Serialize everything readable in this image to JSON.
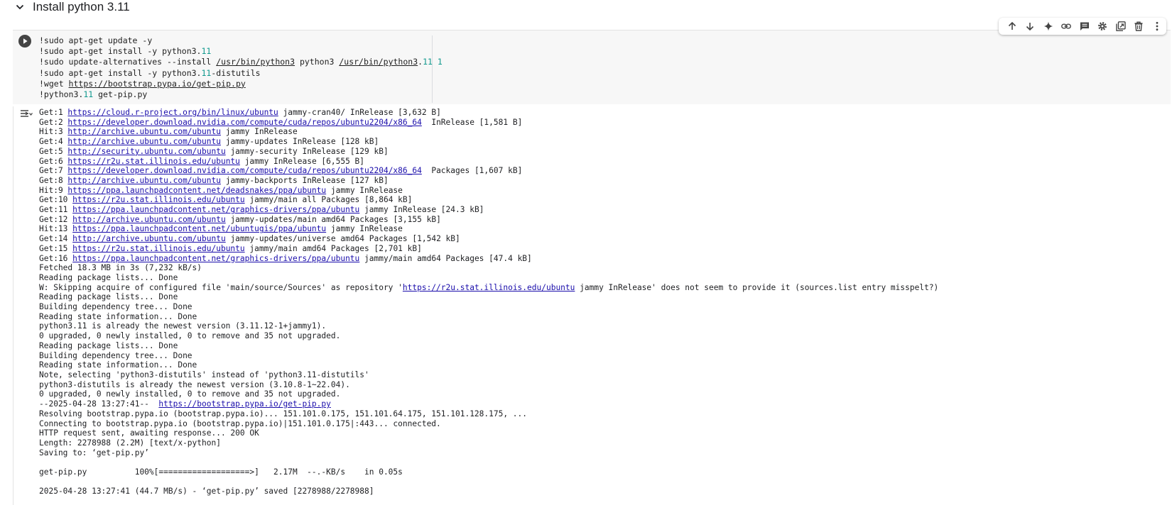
{
  "section": {
    "title": "Install python 3.11"
  },
  "toolbar": {
    "buttons": [
      "move-up",
      "move-down",
      "sparkle",
      "link",
      "comment",
      "settings",
      "mirror",
      "delete",
      "more"
    ]
  },
  "code": [
    [
      {
        "t": "!sudo apt-get update -y"
      }
    ],
    [
      {
        "t": "!sudo apt-get install -y python3."
      },
      {
        "t": "11",
        "c": "num"
      }
    ],
    [
      {
        "t": "!sudo update-alternatives --install "
      },
      {
        "t": "/usr/bin/python3",
        "c": "path"
      },
      {
        "t": " python3 "
      },
      {
        "t": "/usr/bin/python3",
        "c": "path"
      },
      {
        "t": ".",
        "c": ""
      },
      {
        "t": "11",
        "c": "num"
      },
      {
        "t": " "
      },
      {
        "t": "1",
        "c": "num"
      }
    ],
    [
      {
        "t": "!sudo apt-get install -y python3."
      },
      {
        "t": "11",
        "c": "num"
      },
      {
        "t": "-distutils"
      }
    ],
    [
      {
        "t": "!wget "
      },
      {
        "t": "https://bootstrap.pypa.io/get-pip.py",
        "c": "path"
      }
    ],
    [
      {
        "t": "!python3."
      },
      {
        "t": "11",
        "c": "num"
      },
      {
        "t": " get-pip.py"
      }
    ]
  ],
  "output": [
    [
      {
        "t": "Get:1 "
      },
      {
        "t": "https://cloud.r-project.org/bin/linux/ubuntu",
        "l": 1
      },
      {
        "t": " jammy-cran40/ InRelease [3,632 B]"
      }
    ],
    [
      {
        "t": "Get:2 "
      },
      {
        "t": "https://developer.download.nvidia.com/compute/cuda/repos/ubuntu2204/x86_64",
        "l": 1
      },
      {
        "t": "  InRelease [1,581 B]"
      }
    ],
    [
      {
        "t": "Hit:3 "
      },
      {
        "t": "http://archive.ubuntu.com/ubuntu",
        "l": 1
      },
      {
        "t": " jammy InRelease"
      }
    ],
    [
      {
        "t": "Get:4 "
      },
      {
        "t": "http://archive.ubuntu.com/ubuntu",
        "l": 1
      },
      {
        "t": " jammy-updates InRelease [128 kB]"
      }
    ],
    [
      {
        "t": "Get:5 "
      },
      {
        "t": "http://security.ubuntu.com/ubuntu",
        "l": 1
      },
      {
        "t": " jammy-security InRelease [129 kB]"
      }
    ],
    [
      {
        "t": "Get:6 "
      },
      {
        "t": "https://r2u.stat.illinois.edu/ubuntu",
        "l": 1
      },
      {
        "t": " jammy InRelease [6,555 B]"
      }
    ],
    [
      {
        "t": "Get:7 "
      },
      {
        "t": "https://developer.download.nvidia.com/compute/cuda/repos/ubuntu2204/x86_64",
        "l": 1
      },
      {
        "t": "  Packages [1,607 kB]"
      }
    ],
    [
      {
        "t": "Get:8 "
      },
      {
        "t": "http://archive.ubuntu.com/ubuntu",
        "l": 1
      },
      {
        "t": " jammy-backports InRelease [127 kB]"
      }
    ],
    [
      {
        "t": "Hit:9 "
      },
      {
        "t": "https://ppa.launchpadcontent.net/deadsnakes/ppa/ubuntu",
        "l": 1
      },
      {
        "t": " jammy InRelease"
      }
    ],
    [
      {
        "t": "Get:10 "
      },
      {
        "t": "https://r2u.stat.illinois.edu/ubuntu",
        "l": 1
      },
      {
        "t": " jammy/main all Packages [8,864 kB]"
      }
    ],
    [
      {
        "t": "Get:11 "
      },
      {
        "t": "https://ppa.launchpadcontent.net/graphics-drivers/ppa/ubuntu",
        "l": 1
      },
      {
        "t": " jammy InRelease [24.3 kB]"
      }
    ],
    [
      {
        "t": "Get:12 "
      },
      {
        "t": "http://archive.ubuntu.com/ubuntu",
        "l": 1
      },
      {
        "t": " jammy-updates/main amd64 Packages [3,155 kB]"
      }
    ],
    [
      {
        "t": "Hit:13 "
      },
      {
        "t": "https://ppa.launchpadcontent.net/ubuntugis/ppa/ubuntu",
        "l": 1
      },
      {
        "t": " jammy InRelease"
      }
    ],
    [
      {
        "t": "Get:14 "
      },
      {
        "t": "http://archive.ubuntu.com/ubuntu",
        "l": 1
      },
      {
        "t": " jammy-updates/universe amd64 Packages [1,542 kB]"
      }
    ],
    [
      {
        "t": "Get:15 "
      },
      {
        "t": "https://r2u.stat.illinois.edu/ubuntu",
        "l": 1
      },
      {
        "t": " jammy/main amd64 Packages [2,701 kB]"
      }
    ],
    [
      {
        "t": "Get:16 "
      },
      {
        "t": "https://ppa.launchpadcontent.net/graphics-drivers/ppa/ubuntu",
        "l": 1
      },
      {
        "t": " jammy/main amd64 Packages [47.4 kB]"
      }
    ],
    [
      {
        "t": "Fetched 18.3 MB in 3s (7,232 kB/s)"
      }
    ],
    [
      {
        "t": "Reading package lists... Done"
      }
    ],
    [
      {
        "t": "W: Skipping acquire of configured file 'main/source/Sources' as repository '"
      },
      {
        "t": "https://r2u.stat.illinois.edu/ubuntu",
        "l": 1
      },
      {
        "t": " jammy InRelease' does not seem to provide it (sources.list entry misspelt?)"
      }
    ],
    [
      {
        "t": "Reading package lists... Done"
      }
    ],
    [
      {
        "t": "Building dependency tree... Done"
      }
    ],
    [
      {
        "t": "Reading state information... Done"
      }
    ],
    [
      {
        "t": "python3.11 is already the newest version (3.11.12-1+jammy1)."
      }
    ],
    [
      {
        "t": "0 upgraded, 0 newly installed, 0 to remove and 35 not upgraded."
      }
    ],
    [
      {
        "t": "Reading package lists... Done"
      }
    ],
    [
      {
        "t": "Building dependency tree... Done"
      }
    ],
    [
      {
        "t": "Reading state information... Done"
      }
    ],
    [
      {
        "t": "Note, selecting 'python3-distutils' instead of 'python3.11-distutils'"
      }
    ],
    [
      {
        "t": "python3-distutils is already the newest version (3.10.8-1~22.04)."
      }
    ],
    [
      {
        "t": "0 upgraded, 0 newly installed, 0 to remove and 35 not upgraded."
      }
    ],
    [
      {
        "t": "--2025-04-28 13:27:41--  "
      },
      {
        "t": "https://bootstrap.pypa.io/get-pip.py",
        "l": 1
      }
    ],
    [
      {
        "t": "Resolving bootstrap.pypa.io (bootstrap.pypa.io)... 151.101.0.175, 151.101.64.175, 151.101.128.175, ..."
      }
    ],
    [
      {
        "t": "Connecting to bootstrap.pypa.io (bootstrap.pypa.io)|151.101.0.175|:443... connected."
      }
    ],
    [
      {
        "t": "HTTP request sent, awaiting response... 200 OK"
      }
    ],
    [
      {
        "t": "Length: 2278988 (2.2M) [text/x-python]"
      }
    ],
    [
      {
        "t": "Saving to: ‘get-pip.py’"
      }
    ],
    [
      {
        "t": ""
      }
    ],
    [
      {
        "t": "get-pip.py          100%[===================>]   2.17M  --.-KB/s    in 0.05s"
      }
    ],
    [
      {
        "t": ""
      }
    ],
    [
      {
        "t": "2025-04-28 13:27:41 (44.7 MB/s) - ‘get-pip.py’ saved [2278988/2278988]"
      }
    ]
  ]
}
